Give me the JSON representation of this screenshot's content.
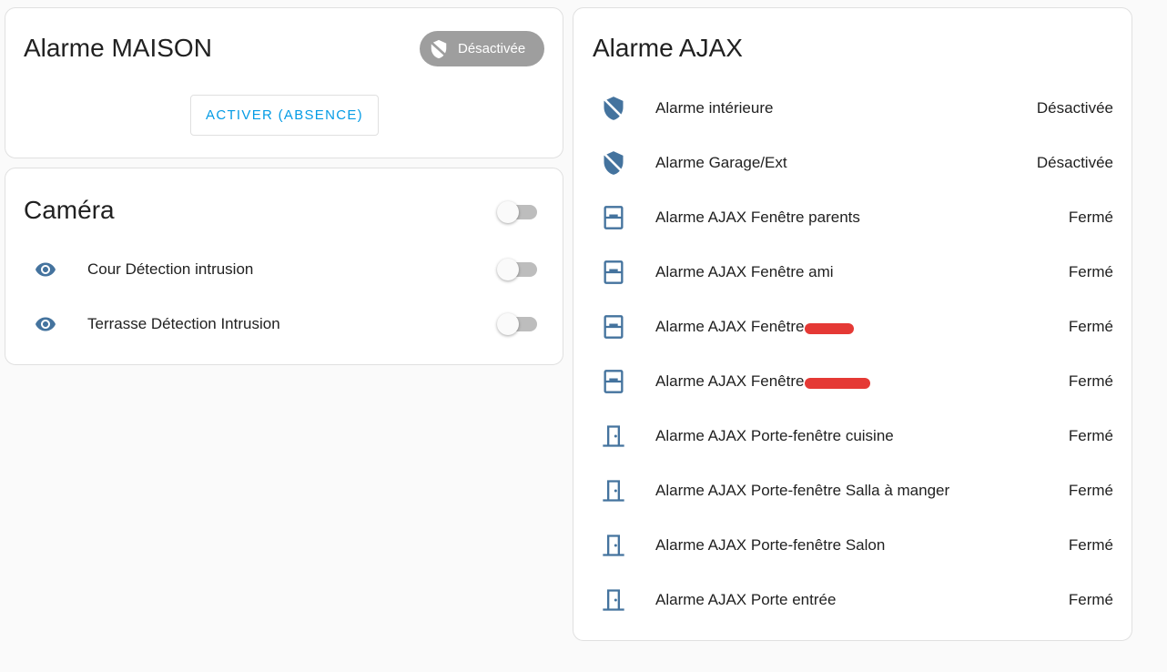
{
  "alarm_card": {
    "title": "Alarme MAISON",
    "state_label": "Désactivée",
    "state_icon": "shield-off-icon",
    "action_label": "ACTIVER (ABSENCE)",
    "badge_color": "#9e9e9e",
    "action_color": "#039be5"
  },
  "camera_card": {
    "title": "Caméra",
    "header_toggle_on": false,
    "rows": [
      {
        "icon": "eye-icon",
        "label": "Cour Détection intrusion",
        "on": false
      },
      {
        "icon": "eye-icon",
        "label": "Terrasse Détection Intrusion",
        "on": false
      }
    ]
  },
  "ajax_card": {
    "title": "Alarme AJAX",
    "icon_color": "#44739e",
    "rows": [
      {
        "icon": "shield-off-icon",
        "label": "Alarme intérieure",
        "value": "Désactivée"
      },
      {
        "icon": "shield-off-icon",
        "label": "Alarme Garage/Ext",
        "value": "Désactivée"
      },
      {
        "icon": "window-closed-icon",
        "label": "Alarme AJAX Fenêtre parents",
        "value": "Fermé"
      },
      {
        "icon": "window-closed-icon",
        "label": "Alarme AJAX Fenêtre ami",
        "value": "Fermé"
      },
      {
        "icon": "window-closed-icon",
        "label": "Alarme AJAX Fenêtre",
        "value": "Fermé",
        "redacted": true
      },
      {
        "icon": "window-closed-icon",
        "label": "Alarme AJAX Fenêtre",
        "value": "Fermé",
        "redacted": true
      },
      {
        "icon": "door-closed-icon",
        "label": "Alarme AJAX Porte-fenêtre cuisine",
        "value": "Fermé"
      },
      {
        "icon": "door-closed-icon",
        "label": "Alarme AJAX Porte-fenêtre Salla à manger",
        "value": "Fermé"
      },
      {
        "icon": "door-closed-icon",
        "label": "Alarme AJAX Porte-fenêtre Salon",
        "value": "Fermé"
      },
      {
        "icon": "door-closed-icon",
        "label": "Alarme AJAX Porte entrée",
        "value": "Fermé"
      }
    ]
  }
}
